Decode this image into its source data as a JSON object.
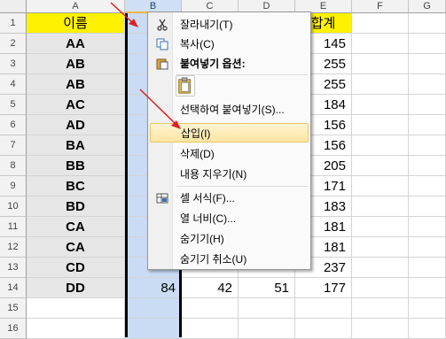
{
  "columns": [
    "A",
    "B",
    "C",
    "D",
    "E",
    "F",
    "G"
  ],
  "rows": [
    "1",
    "2",
    "3",
    "4",
    "5",
    "6",
    "7",
    "8",
    "9",
    "10",
    "11",
    "12",
    "13",
    "14",
    "15",
    "16"
  ],
  "header_row": {
    "a": "이름",
    "b": "과",
    "e": "합계"
  },
  "data_rows": [
    {
      "name": "AA",
      "total": "145"
    },
    {
      "name": "AB",
      "total": "255"
    },
    {
      "name": "AB",
      "total": "255"
    },
    {
      "name": "AC",
      "total": "184"
    },
    {
      "name": "AD",
      "total": "156"
    },
    {
      "name": "BA",
      "total": "156"
    },
    {
      "name": "BB",
      "total": "205"
    },
    {
      "name": "BC",
      "total": "171"
    },
    {
      "name": "BD",
      "total": "183"
    },
    {
      "name": "CA",
      "total": "181"
    },
    {
      "name": "CA",
      "total": "181"
    },
    {
      "name": "CD",
      "b": "",
      "c": "",
      "d": "",
      "total": "237"
    },
    {
      "name": "DD",
      "b": "84",
      "c": "42",
      "d": "51",
      "total": "177"
    }
  ],
  "context_menu": {
    "cut": "잘라내기(T)",
    "copy": "복사(C)",
    "paste_options": "붙여넣기 옵션:",
    "paste_special": "선택하여 붙여넣기(S)...",
    "insert": "삽입(I)",
    "delete": "삭제(D)",
    "clear_contents": "내용 지우기(N)",
    "format_cells": "셀 서식(F)...",
    "column_width": "열 너비(C)...",
    "hide": "숨기기(H)",
    "unhide": "숨기기 취소(U)"
  },
  "colors": {
    "header_fill": "#fff200",
    "selected_column": "#c9dcf4",
    "arrow": "#e02020"
  }
}
